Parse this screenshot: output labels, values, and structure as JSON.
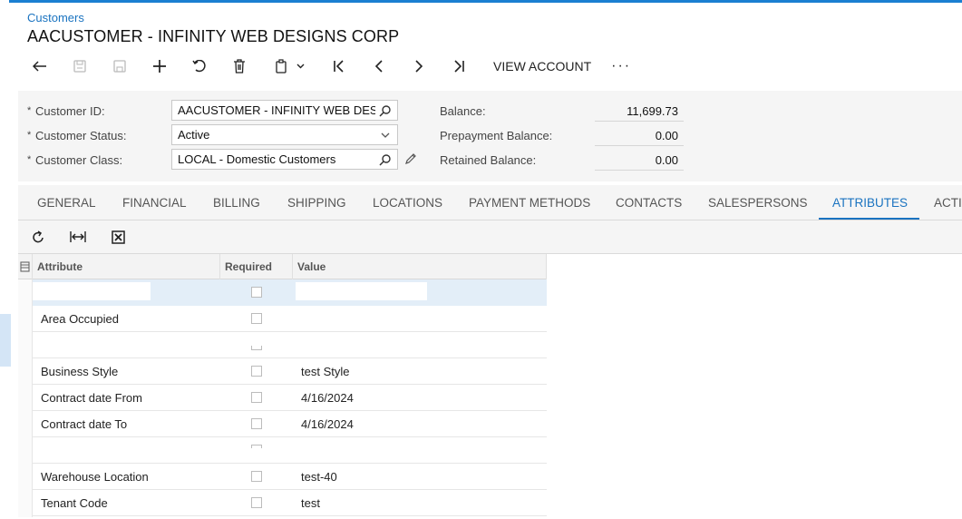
{
  "breadcrumb": "Customers",
  "page_title": "AACUSTOMER - INFINITY WEB DESIGNS CORP",
  "toolbar": {
    "view_account_label": "VIEW ACCOUNT",
    "more_label": "···"
  },
  "form": {
    "customer_id_label": "Customer ID:",
    "customer_id_value": "AACUSTOMER - INFINITY WEB DES",
    "customer_status_label": "Customer Status:",
    "customer_status_value": "Active",
    "customer_class_label": "Customer Class:",
    "customer_class_value": "LOCAL - Domestic Customers",
    "required_marker": "*"
  },
  "balances": {
    "balance_label": "Balance:",
    "balance_value": "11,699.73",
    "prepayment_label": "Prepayment Balance:",
    "prepayment_value": "0.00",
    "retained_label": "Retained Balance:",
    "retained_value": "0.00"
  },
  "tabs": [
    {
      "label": "GENERAL"
    },
    {
      "label": "FINANCIAL"
    },
    {
      "label": "BILLING"
    },
    {
      "label": "SHIPPING"
    },
    {
      "label": "LOCATIONS"
    },
    {
      "label": "PAYMENT METHODS"
    },
    {
      "label": "CONTACTS"
    },
    {
      "label": "SALESPERSONS"
    },
    {
      "label": "ATTRIBUTES"
    },
    {
      "label": "ACTI"
    }
  ],
  "active_tab": "ATTRIBUTES",
  "grid": {
    "columns": {
      "attribute": "Attribute",
      "required": "Required",
      "value": "Value"
    },
    "rows": [
      {
        "attribute": "",
        "value": ""
      },
      {
        "attribute": "Area Occupied",
        "value": ""
      },
      {
        "attribute": "",
        "value": ""
      },
      {
        "attribute": "Business Style",
        "value": "test Style"
      },
      {
        "attribute": "Contract date From",
        "value": "4/16/2024"
      },
      {
        "attribute": "Contract date To",
        "value": "4/16/2024"
      },
      {
        "attribute": "",
        "value": ""
      },
      {
        "attribute": "Warehouse Location",
        "value": "test-40"
      },
      {
        "attribute": "Tenant Code",
        "value": "test"
      }
    ]
  },
  "colors": {
    "accent": "#1a73c0",
    "panel_bg": "#f5f5f5",
    "selected_row": "#e3eef8"
  }
}
